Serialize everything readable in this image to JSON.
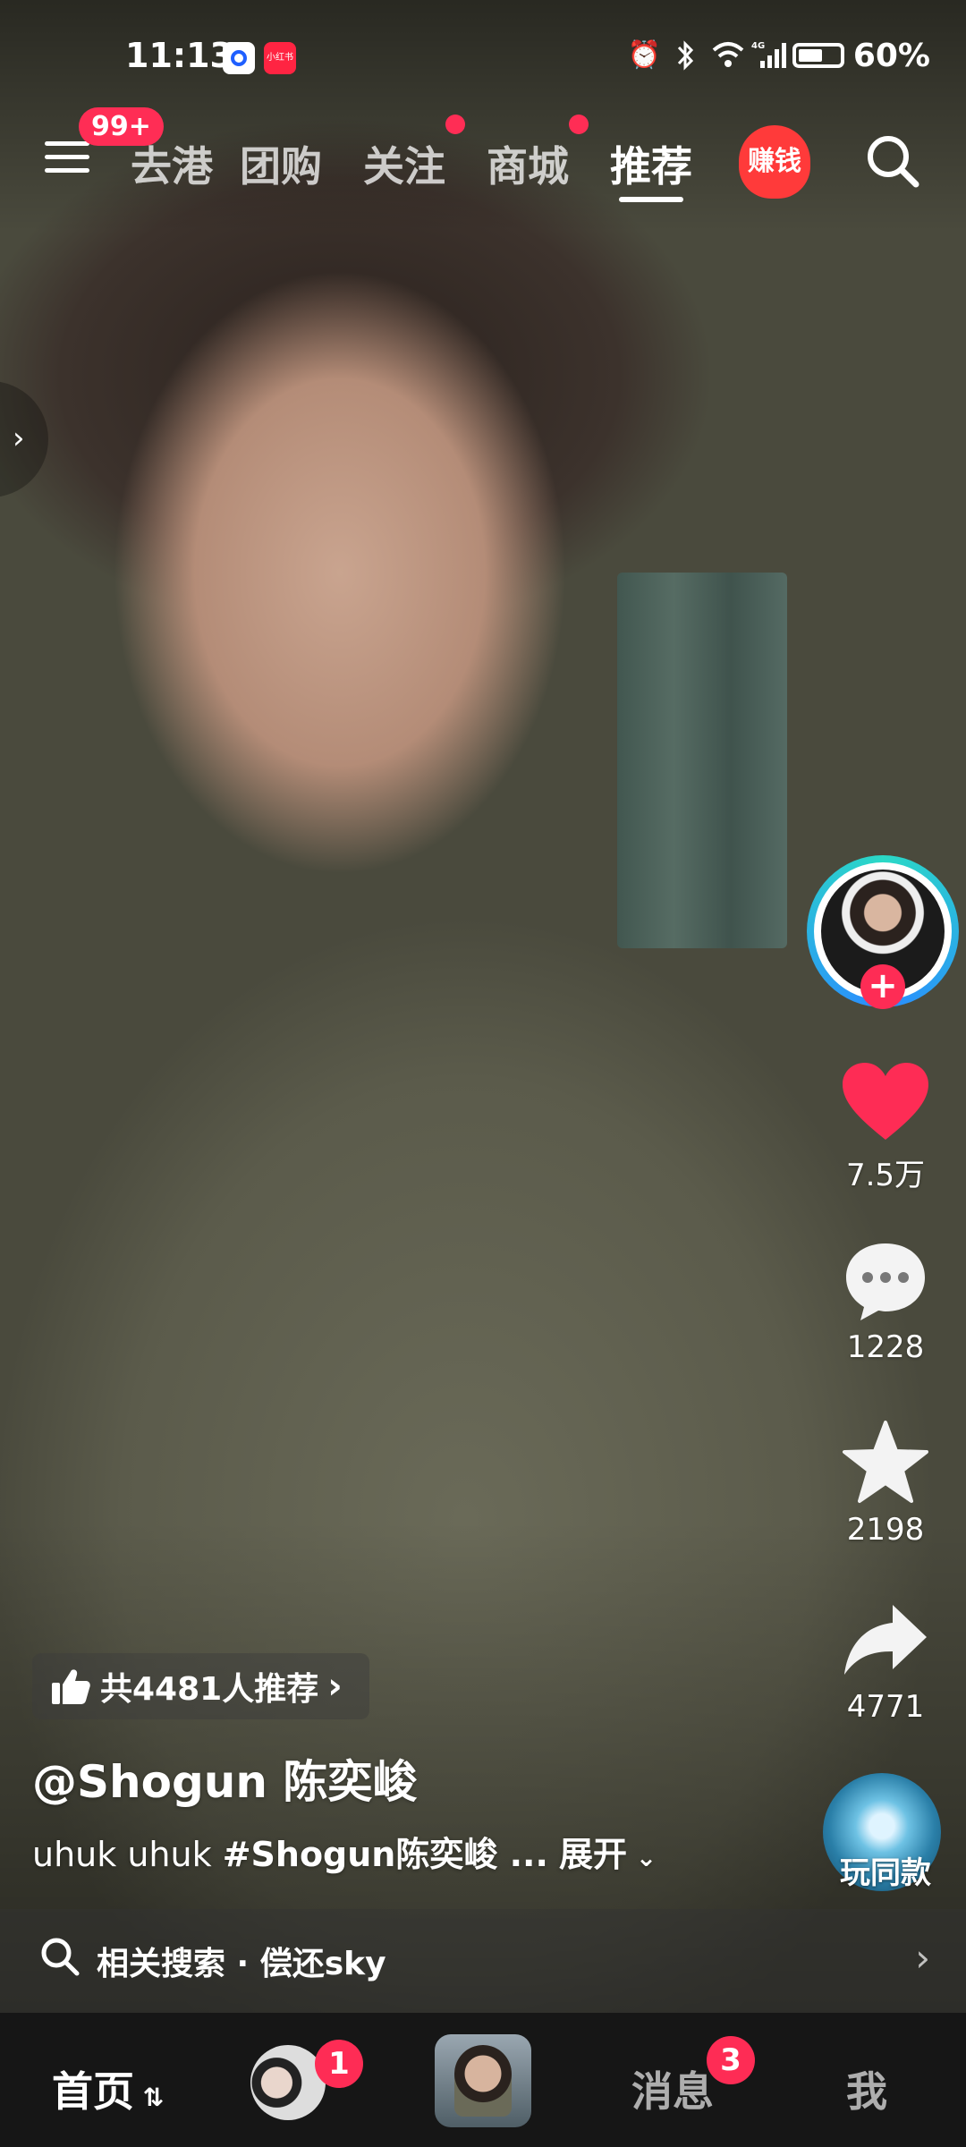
{
  "status_bar": {
    "time": "11:13",
    "app_badge": "小红书",
    "battery": "60%",
    "icons": [
      "alarm-icon",
      "bluetooth-icon",
      "wifi-icon",
      "4g-signal-icon",
      "battery-icon"
    ]
  },
  "top_nav": {
    "menu_badge": "99+",
    "tabs": [
      "去港",
      "团购",
      "关注",
      "商城",
      "推荐"
    ],
    "active_tab": "推荐",
    "earn_label": "赚钱"
  },
  "actions": {
    "likes": "7.5万",
    "comments": "1228",
    "favorites": "2198",
    "shares": "4771",
    "play_same": "玩同款"
  },
  "video": {
    "recommend_count": "共4481人推荐",
    "author": "@Shogun 陈奕峻",
    "caption_text": "uhuk uhuk ",
    "caption_tag": "#Shogun陈奕峻 ...",
    "expand": "展开"
  },
  "related_search": {
    "label": "相关搜索 · 偿还sky"
  },
  "bottom_nav": {
    "home": "首页",
    "friends_badge": "1",
    "messages": "消息",
    "messages_badge": "3",
    "me": "我"
  },
  "colors": {
    "accent": "#fe2c55",
    "tab_bar": "#161616"
  }
}
